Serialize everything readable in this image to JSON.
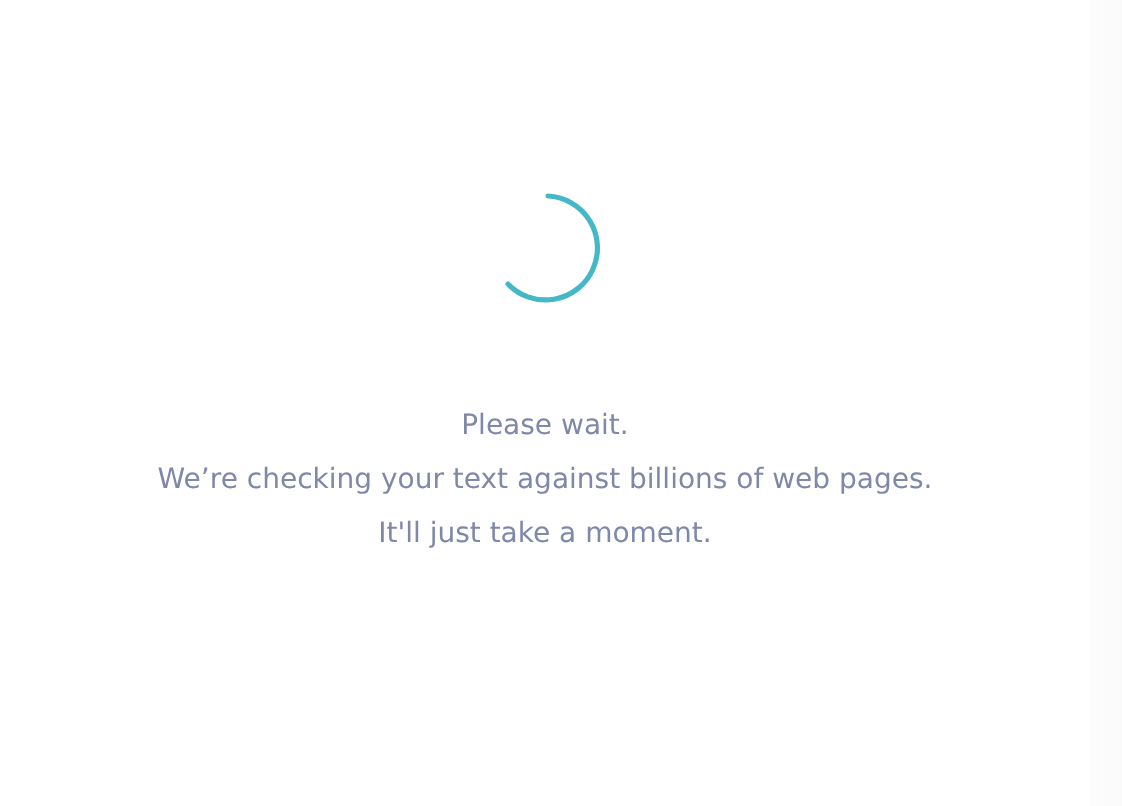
{
  "message": {
    "lines": [
      "Please wait.",
      "We’re checking your text against billions of web pages.",
      "It'll just take a moment."
    ]
  }
}
